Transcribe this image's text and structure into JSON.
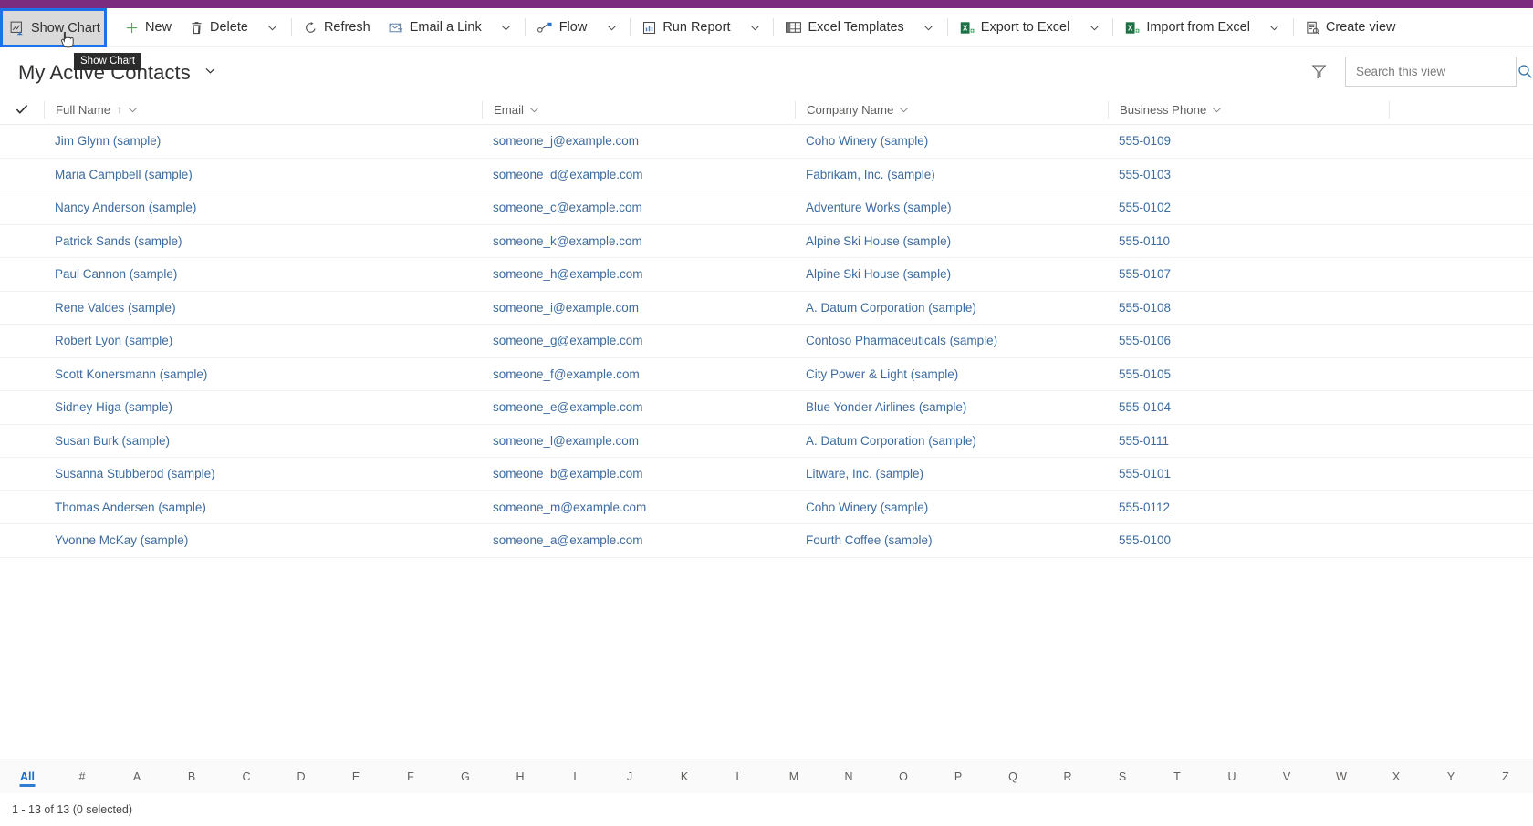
{
  "app": {
    "accent_purple": "#7B2C7E",
    "highlight_blue": "#1a73e8",
    "link_color": "#3c6ba0"
  },
  "command_bar": {
    "show_chart": {
      "label": "Show Chart",
      "icon": "chart-icon"
    },
    "tooltip": "Show Chart",
    "items": [
      {
        "label": "New",
        "icon": "plus-icon",
        "chevron": false
      },
      {
        "label": "Delete",
        "icon": "trash-icon",
        "chevron": true
      },
      {
        "label": "Refresh",
        "icon": "refresh-icon",
        "chevron": false
      },
      {
        "label": "Email a Link",
        "icon": "email-link-icon",
        "chevron": true
      },
      {
        "label": "Flow",
        "icon": "flow-icon",
        "chevron": true
      },
      {
        "label": "Run Report",
        "icon": "report-icon",
        "chevron": true
      },
      {
        "label": "Excel Templates",
        "icon": "excel-template-icon",
        "chevron": true
      },
      {
        "label": "Export to Excel",
        "icon": "excel-export-icon",
        "chevron": true
      },
      {
        "label": "Import from Excel",
        "icon": "excel-import-icon",
        "chevron": true
      },
      {
        "label": "Create view",
        "icon": "create-view-icon",
        "chevron": false
      }
    ]
  },
  "view": {
    "title": "My Active Contacts",
    "title_chevron": "chevron-down-icon",
    "filter_icon": "filter-icon"
  },
  "search": {
    "placeholder": "Search this view",
    "value": "",
    "icon": "search-icon"
  },
  "grid": {
    "select_all_icon": "checkmark-icon",
    "columns": [
      {
        "label": "Full Name",
        "sorted": true,
        "sort_dir": "ascending",
        "sort_glyph": "↑"
      },
      {
        "label": "Email",
        "sorted": false,
        "sort_dir": "",
        "sort_glyph": ""
      },
      {
        "label": "Company Name",
        "sorted": false,
        "sort_dir": "",
        "sort_glyph": ""
      },
      {
        "label": "Business Phone",
        "sorted": false,
        "sort_dir": "",
        "sort_glyph": ""
      }
    ],
    "rows": [
      {
        "full_name": "Jim Glynn (sample)",
        "email": "someone_j@example.com",
        "company": "Coho Winery (sample)",
        "phone": "555-0109"
      },
      {
        "full_name": "Maria Campbell (sample)",
        "email": "someone_d@example.com",
        "company": "Fabrikam, Inc. (sample)",
        "phone": "555-0103"
      },
      {
        "full_name": "Nancy Anderson (sample)",
        "email": "someone_c@example.com",
        "company": "Adventure Works (sample)",
        "phone": "555-0102"
      },
      {
        "full_name": "Patrick Sands (sample)",
        "email": "someone_k@example.com",
        "company": "Alpine Ski House (sample)",
        "phone": "555-0110"
      },
      {
        "full_name": "Paul Cannon (sample)",
        "email": "someone_h@example.com",
        "company": "Alpine Ski House (sample)",
        "phone": "555-0107"
      },
      {
        "full_name": "Rene Valdes (sample)",
        "email": "someone_i@example.com",
        "company": "A. Datum Corporation (sample)",
        "phone": "555-0108"
      },
      {
        "full_name": "Robert Lyon (sample)",
        "email": "someone_g@example.com",
        "company": "Contoso Pharmaceuticals (sample)",
        "phone": "555-0106"
      },
      {
        "full_name": "Scott Konersmann (sample)",
        "email": "someone_f@example.com",
        "company": "City Power & Light (sample)",
        "phone": "555-0105"
      },
      {
        "full_name": "Sidney Higa (sample)",
        "email": "someone_e@example.com",
        "company": "Blue Yonder Airlines (sample)",
        "phone": "555-0104"
      },
      {
        "full_name": "Susan Burk (sample)",
        "email": "someone_l@example.com",
        "company": "A. Datum Corporation (sample)",
        "phone": "555-0111"
      },
      {
        "full_name": "Susanna Stubberod (sample)",
        "email": "someone_b@example.com",
        "company": "Litware, Inc. (sample)",
        "phone": "555-0101"
      },
      {
        "full_name": "Thomas Andersen (sample)",
        "email": "someone_m@example.com",
        "company": "Coho Winery (sample)",
        "phone": "555-0112"
      },
      {
        "full_name": "Yvonne McKay (sample)",
        "email": "someone_a@example.com",
        "company": "Fourth Coffee (sample)",
        "phone": "555-0100"
      }
    ]
  },
  "alpha_bar": {
    "selected": "All",
    "items": [
      "All",
      "#",
      "A",
      "B",
      "C",
      "D",
      "E",
      "F",
      "G",
      "H",
      "I",
      "J",
      "K",
      "L",
      "M",
      "N",
      "O",
      "P",
      "Q",
      "R",
      "S",
      "T",
      "U",
      "V",
      "W",
      "X",
      "Y",
      "Z"
    ]
  },
  "status": {
    "text": "1 - 13 of 13 (0 selected)"
  }
}
